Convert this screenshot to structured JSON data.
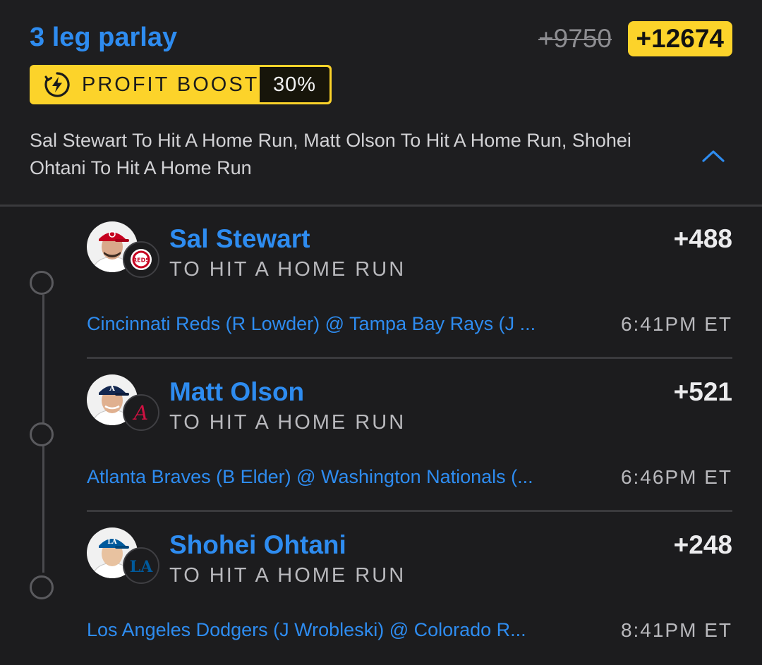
{
  "parlay": {
    "title": "3 leg parlay",
    "original_odds": "+9750",
    "boosted_odds": "+12674",
    "boost_label": "PROFIT BOOST",
    "boost_percent": "30%",
    "legs_summary": "Sal Stewart To Hit A Home Run, Matt Olson To Hit A Home Run, Shohei Ohtani To Hit A Home Run",
    "collapse_icon": "chevron-up-icon"
  },
  "legs": [
    {
      "player": "Sal Stewart",
      "market": "TO HIT A HOME RUN",
      "odds": "+488",
      "matchup": "Cincinnati Reds (R Lowder) @ Tampa Bay Rays (J ...",
      "time": "6:41PM ET",
      "team_logo": "reds-logo-icon",
      "team_color": "#c6011f"
    },
    {
      "player": "Matt Olson",
      "market": "TO HIT A HOME RUN",
      "odds": "+521",
      "matchup": "Atlanta Braves (B Elder) @ Washington Nationals (...",
      "time": "6:46PM ET",
      "team_logo": "braves-logo-icon",
      "team_color": "#ce1141"
    },
    {
      "player": "Shohei Ohtani",
      "market": "TO HIT A HOME RUN",
      "odds": "+248",
      "matchup": "Los Angeles Dodgers (J Wrobleski) @ Colorado R...",
      "time": "8:41PM ET",
      "team_logo": "dodgers-logo-icon",
      "team_color": "#005a9c"
    }
  ],
  "colors": {
    "accent_blue": "#2e8cf0",
    "boost_yellow": "#fcd32a",
    "background": "#1c1c1e"
  }
}
